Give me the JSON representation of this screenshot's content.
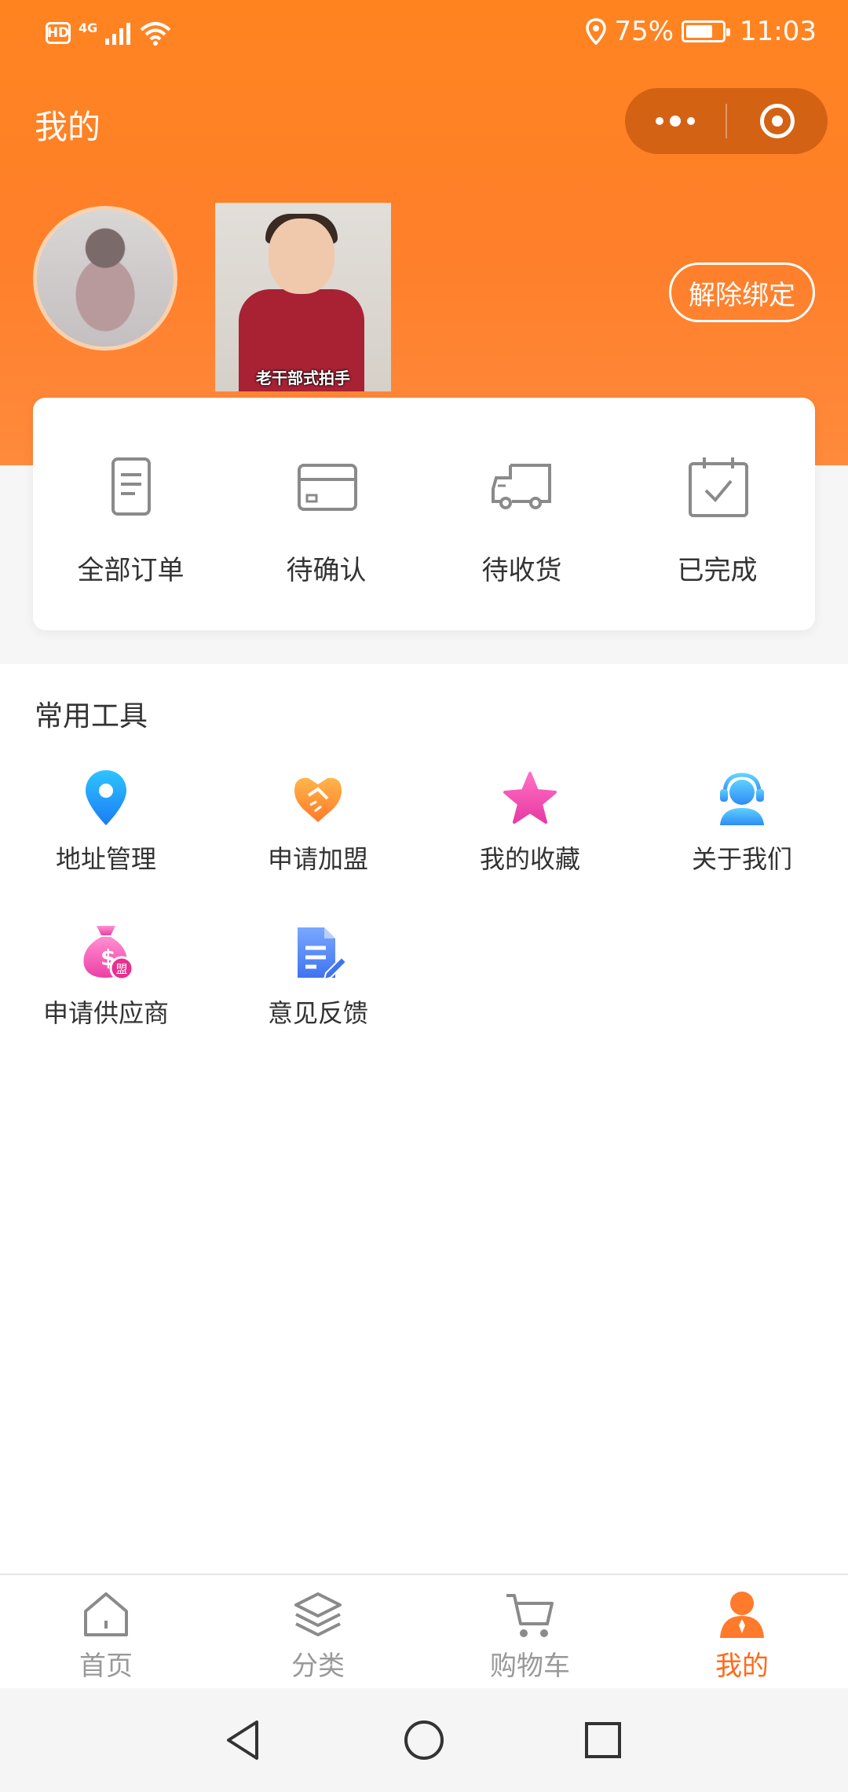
{
  "status_bar": {
    "hd": "HD",
    "network": "4G",
    "battery_percent": "75%",
    "battery_level": 0.75,
    "time": "11:03"
  },
  "header": {
    "title": "我的",
    "accent_color": "#ff8420",
    "menu_icon": "more-dots-icon",
    "close_icon": "target-circle-icon"
  },
  "profile": {
    "avatar": "avatar",
    "sticker_caption": "老干部式拍手",
    "unbind_label": "解除绑定"
  },
  "orders": {
    "items": [
      {
        "label": "全部订单",
        "icon": "document-icon"
      },
      {
        "label": "待确认",
        "icon": "card-icon"
      },
      {
        "label": "待收货",
        "icon": "truck-icon"
      },
      {
        "label": "已完成",
        "icon": "calendar-check-icon"
      }
    ]
  },
  "tools": {
    "title": "常用工具",
    "items": [
      {
        "label": "地址管理",
        "icon": "location-pin-icon"
      },
      {
        "label": "申请加盟",
        "icon": "handshake-icon"
      },
      {
        "label": "我的收藏",
        "icon": "star-icon"
      },
      {
        "label": "关于我们",
        "icon": "customer-service-icon"
      },
      {
        "label": "申请供应商",
        "icon": "money-bag-icon",
        "badge": "盟"
      },
      {
        "label": "意见反馈",
        "icon": "feedback-edit-icon"
      }
    ]
  },
  "tabbar": {
    "items": [
      {
        "label": "首页",
        "icon": "home-icon",
        "active": false
      },
      {
        "label": "分类",
        "icon": "layers-icon",
        "active": false
      },
      {
        "label": "购物车",
        "icon": "cart-icon",
        "active": false
      },
      {
        "label": "我的",
        "icon": "user-icon",
        "active": true
      }
    ],
    "active_color": "#ff6a1a"
  },
  "system_nav": {
    "back_icon": "back-triangle-icon",
    "home_icon": "home-circle-icon",
    "recents_icon": "recents-square-icon"
  }
}
